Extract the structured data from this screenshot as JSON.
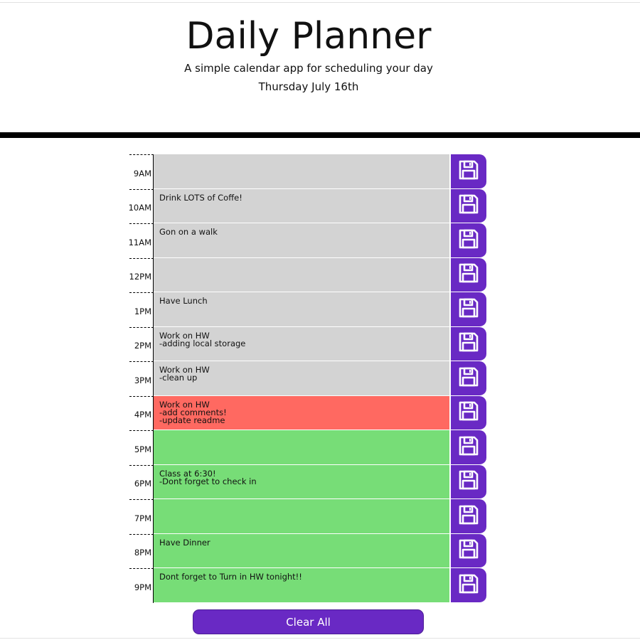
{
  "header": {
    "title": "Daily Planner",
    "subtitle": "A simple calendar app for scheduling your day",
    "current_day": "Thursday July 16th"
  },
  "colors": {
    "past": "#d3d3d3",
    "present": "#ff6961",
    "future": "#77dd77",
    "accent": "#6929c4"
  },
  "time_blocks": [
    {
      "hour": "9AM",
      "status": "past",
      "text": ""
    },
    {
      "hour": "10AM",
      "status": "past",
      "text": "Drink LOTS of Coffe!"
    },
    {
      "hour": "11AM",
      "status": "past",
      "text": "Gon on a walk"
    },
    {
      "hour": "12PM",
      "status": "past",
      "text": ""
    },
    {
      "hour": "1PM",
      "status": "past",
      "text": "Have Lunch"
    },
    {
      "hour": "2PM",
      "status": "past",
      "text": "Work on HW\n-adding local storage"
    },
    {
      "hour": "3PM",
      "status": "past",
      "text": "Work on HW\n-clean up"
    },
    {
      "hour": "4PM",
      "status": "present",
      "text": "Work on HW\n-add comments!\n-update readme"
    },
    {
      "hour": "5PM",
      "status": "future",
      "text": ""
    },
    {
      "hour": "6PM",
      "status": "future",
      "text": "Class at 6:30!\n-Dont forget to check in"
    },
    {
      "hour": "7PM",
      "status": "future",
      "text": ""
    },
    {
      "hour": "8PM",
      "status": "future",
      "text": "Have Dinner"
    },
    {
      "hour": "9PM",
      "status": "future",
      "text": "Dont forget to Turn in HW tonight!!"
    }
  ],
  "save_icon": "floppy-disk-icon",
  "clear_button": {
    "label": "Clear All"
  }
}
